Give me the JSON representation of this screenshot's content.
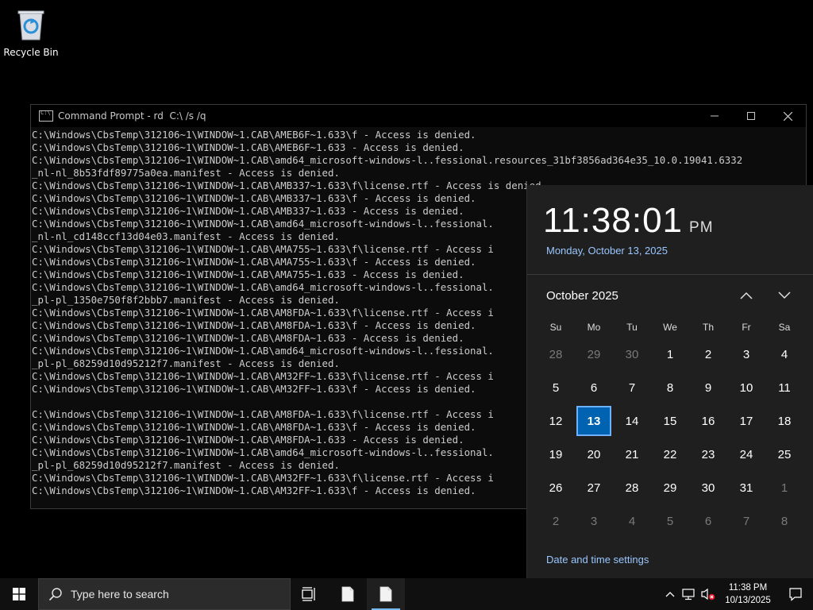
{
  "desktop": {
    "recycle_bin_label": "Recycle Bin"
  },
  "cmd": {
    "title": "Command Prompt - rd  C:\\ /s /q",
    "lines": [
      "C:\\Windows\\CbsTemp\\312106~1\\WINDOW~1.CAB\\AMEB6F~1.633\\f - Access is denied.",
      "C:\\Windows\\CbsTemp\\312106~1\\WINDOW~1.CAB\\AMEB6F~1.633 - Access is denied.",
      "C:\\Windows\\CbsTemp\\312106~1\\WINDOW~1.CAB\\amd64_microsoft-windows-l..fessional.resources_31bf3856ad364e35_10.0.19041.6332",
      "_nl-nl_8b53fdf89775a0ea.manifest - Access is denied.",
      "C:\\Windows\\CbsTemp\\312106~1\\WINDOW~1.CAB\\AMB337~1.633\\f\\license.rtf - Access is denied.",
      "C:\\Windows\\CbsTemp\\312106~1\\WINDOW~1.CAB\\AMB337~1.633\\f - Access is denied.",
      "C:\\Windows\\CbsTemp\\312106~1\\WINDOW~1.CAB\\AMB337~1.633 - Access is denied.",
      "C:\\Windows\\CbsTemp\\312106~1\\WINDOW~1.CAB\\amd64_microsoft-windows-l..fessional.",
      "_nl-nl_cd148ccf13d04e03.manifest - Access is denied.",
      "C:\\Windows\\CbsTemp\\312106~1\\WINDOW~1.CAB\\AMA755~1.633\\f\\license.rtf - Access i",
      "C:\\Windows\\CbsTemp\\312106~1\\WINDOW~1.CAB\\AMA755~1.633\\f - Access is denied.",
      "C:\\Windows\\CbsTemp\\312106~1\\WINDOW~1.CAB\\AMA755~1.633 - Access is denied.",
      "C:\\Windows\\CbsTemp\\312106~1\\WINDOW~1.CAB\\amd64_microsoft-windows-l..fessional.",
      "_pl-pl_1350e750f8f2bbb7.manifest - Access is denied.",
      "C:\\Windows\\CbsTemp\\312106~1\\WINDOW~1.CAB\\AM8FDA~1.633\\f\\license.rtf - Access i",
      "C:\\Windows\\CbsTemp\\312106~1\\WINDOW~1.CAB\\AM8FDA~1.633\\f - Access is denied.",
      "C:\\Windows\\CbsTemp\\312106~1\\WINDOW~1.CAB\\AM8FDA~1.633 - Access is denied.",
      "C:\\Windows\\CbsTemp\\312106~1\\WINDOW~1.CAB\\amd64_microsoft-windows-l..fessional.",
      "_pl-pl_68259d10d95212f7.manifest - Access is denied.",
      "C:\\Windows\\CbsTemp\\312106~1\\WINDOW~1.CAB\\AM32FF~1.633\\f\\license.rtf - Access i",
      "C:\\Windows\\CbsTemp\\312106~1\\WINDOW~1.CAB\\AM32FF~1.633\\f - Access is denied.",
      "",
      "C:\\Windows\\CbsTemp\\312106~1\\WINDOW~1.CAB\\AM8FDA~1.633\\f\\license.rtf - Access i",
      "C:\\Windows\\CbsTemp\\312106~1\\WINDOW~1.CAB\\AM8FDA~1.633\\f - Access is denied.",
      "C:\\Windows\\CbsTemp\\312106~1\\WINDOW~1.CAB\\AM8FDA~1.633 - Access is denied.",
      "C:\\Windows\\CbsTemp\\312106~1\\WINDOW~1.CAB\\amd64_microsoft-windows-l..fessional.",
      "_pl-pl_68259d10d95212f7.manifest - Access is denied.",
      "C:\\Windows\\CbsTemp\\312106~1\\WINDOW~1.CAB\\AM32FF~1.633\\f\\license.rtf - Access i",
      "C:\\Windows\\CbsTemp\\312106~1\\WINDOW~1.CAB\\AM32FF~1.633\\f - Access is denied."
    ]
  },
  "flyout": {
    "time": "11:38:01",
    "ampm": "PM",
    "long_date": "Monday, October 13, 2025",
    "month_title": "October 2025",
    "weekdays": [
      "Su",
      "Mo",
      "Tu",
      "We",
      "Th",
      "Fr",
      "Sa"
    ],
    "weeks": [
      [
        {
          "d": "28",
          "dim": true
        },
        {
          "d": "29",
          "dim": true
        },
        {
          "d": "30",
          "dim": true
        },
        {
          "d": "1"
        },
        {
          "d": "2"
        },
        {
          "d": "3"
        },
        {
          "d": "4"
        }
      ],
      [
        {
          "d": "5"
        },
        {
          "d": "6"
        },
        {
          "d": "7"
        },
        {
          "d": "8"
        },
        {
          "d": "9"
        },
        {
          "d": "10"
        },
        {
          "d": "11"
        }
      ],
      [
        {
          "d": "12"
        },
        {
          "d": "13",
          "today": true
        },
        {
          "d": "14"
        },
        {
          "d": "15"
        },
        {
          "d": "16"
        },
        {
          "d": "17"
        },
        {
          "d": "18"
        }
      ],
      [
        {
          "d": "19"
        },
        {
          "d": "20"
        },
        {
          "d": "21"
        },
        {
          "d": "22"
        },
        {
          "d": "23"
        },
        {
          "d": "24"
        },
        {
          "d": "25"
        }
      ],
      [
        {
          "d": "26"
        },
        {
          "d": "27"
        },
        {
          "d": "28"
        },
        {
          "d": "29"
        },
        {
          "d": "30"
        },
        {
          "d": "31"
        },
        {
          "d": "1",
          "dim": true
        }
      ],
      [
        {
          "d": "2",
          "dim": true
        },
        {
          "d": "3",
          "dim": true
        },
        {
          "d": "4",
          "dim": true
        },
        {
          "d": "5",
          "dim": true
        },
        {
          "d": "6",
          "dim": true
        },
        {
          "d": "7",
          "dim": true
        },
        {
          "d": "8",
          "dim": true
        }
      ]
    ],
    "settings_link": "Date and time settings"
  },
  "taskbar": {
    "search_placeholder": "Type here to search",
    "clock_time": "11:38 PM",
    "clock_date": "10/13/2025"
  },
  "colors": {
    "today_bg": "#0063b1",
    "link": "#99c7ff",
    "taskbar_active_indicator": "#76b9ed"
  }
}
